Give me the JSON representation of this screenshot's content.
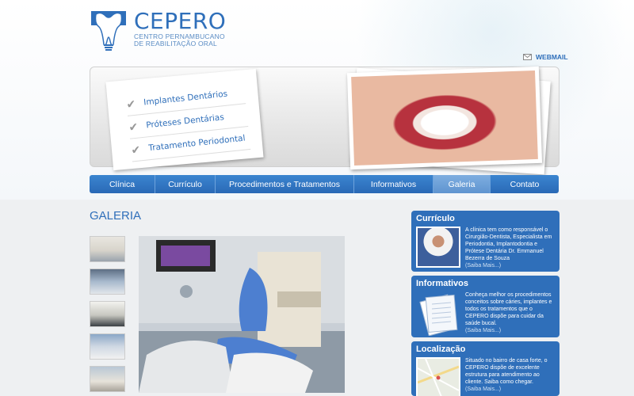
{
  "brand": {
    "name": "CEPERO",
    "subtitle_line1": "CENTRO PERNAMBUCANO",
    "subtitle_line2": "DE REABILITAÇÃO ORAL"
  },
  "header": {
    "webmail_label": "WEBMAIL"
  },
  "banner": {
    "items": [
      "Implantes Dentários",
      "Próteses Dentárias",
      "Tratamento Periodontal"
    ]
  },
  "nav": {
    "items": [
      {
        "label": "Clínica"
      },
      {
        "label": "Currículo"
      },
      {
        "label": "Procedimentos e Tratamentos"
      },
      {
        "label": "Informativos"
      },
      {
        "label": "Galeria"
      },
      {
        "label": "Contato"
      }
    ],
    "active": "Galeria"
  },
  "main": {
    "title": "GALERIA"
  },
  "sidebar": {
    "curriculo": {
      "title": "Currículo",
      "text": "A clínica tem como responsável o Cirurgião-Dentista, Especialista em Periodontia, Implantodontia e Prótese Dentária Dr. Emmanuel Bezerra de Souza",
      "more": "(Saiba Mais...)"
    },
    "informativos": {
      "title": "Informativos",
      "text": "Conheça melhor os procedimentos conceitos sobre cáries, implantes e todos os tratamentos que o CEPERO dispõe para cuidar da saúde bucal.",
      "more": "(Saiba Mais...)"
    },
    "localizacao": {
      "title": "Localização",
      "text": "Situado no bairro de casa forte, o CEPERO dispõe de excelente estrutura para atendimento ao cliente. Saiba como chegar.",
      "more": "(Saiba Mais...)"
    }
  },
  "colors": {
    "brand_blue": "#2f6fba",
    "nav_active": "#6fa2d8"
  }
}
